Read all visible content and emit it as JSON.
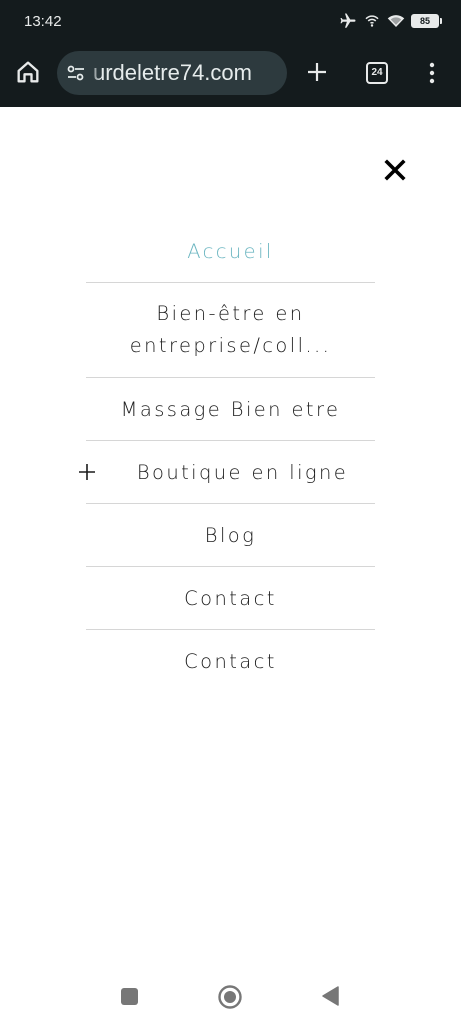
{
  "status_bar": {
    "time": "13:42",
    "battery": "85",
    "icons": [
      "airplane-icon",
      "hotspot-icon",
      "wifi-icon",
      "battery-icon"
    ]
  },
  "browser": {
    "url": "urdeletre74.com",
    "tab_count": "24",
    "icons": [
      "home-icon",
      "site-settings-icon",
      "new-tab-icon",
      "tabs-icon",
      "more-icon"
    ]
  },
  "menu": {
    "items": [
      {
        "label": "Accueil",
        "active": true
      },
      {
        "label": "Bien-être en entreprise/coll...",
        "active": false
      },
      {
        "label": "Massage Bien etre",
        "active": false
      },
      {
        "label": "Boutique en ligne",
        "active": false,
        "expandable": true
      },
      {
        "label": "Blog",
        "active": false
      },
      {
        "label": "Contact",
        "active": false
      },
      {
        "label": "Contact",
        "active": false
      }
    ],
    "active_color": "#6cb6c1",
    "text_color": "#1c1c1c"
  },
  "theme": {
    "chrome_bg": "#141b1d",
    "url_bar_bg": "#2d3a3e",
    "page_bg": "#ffffff"
  }
}
